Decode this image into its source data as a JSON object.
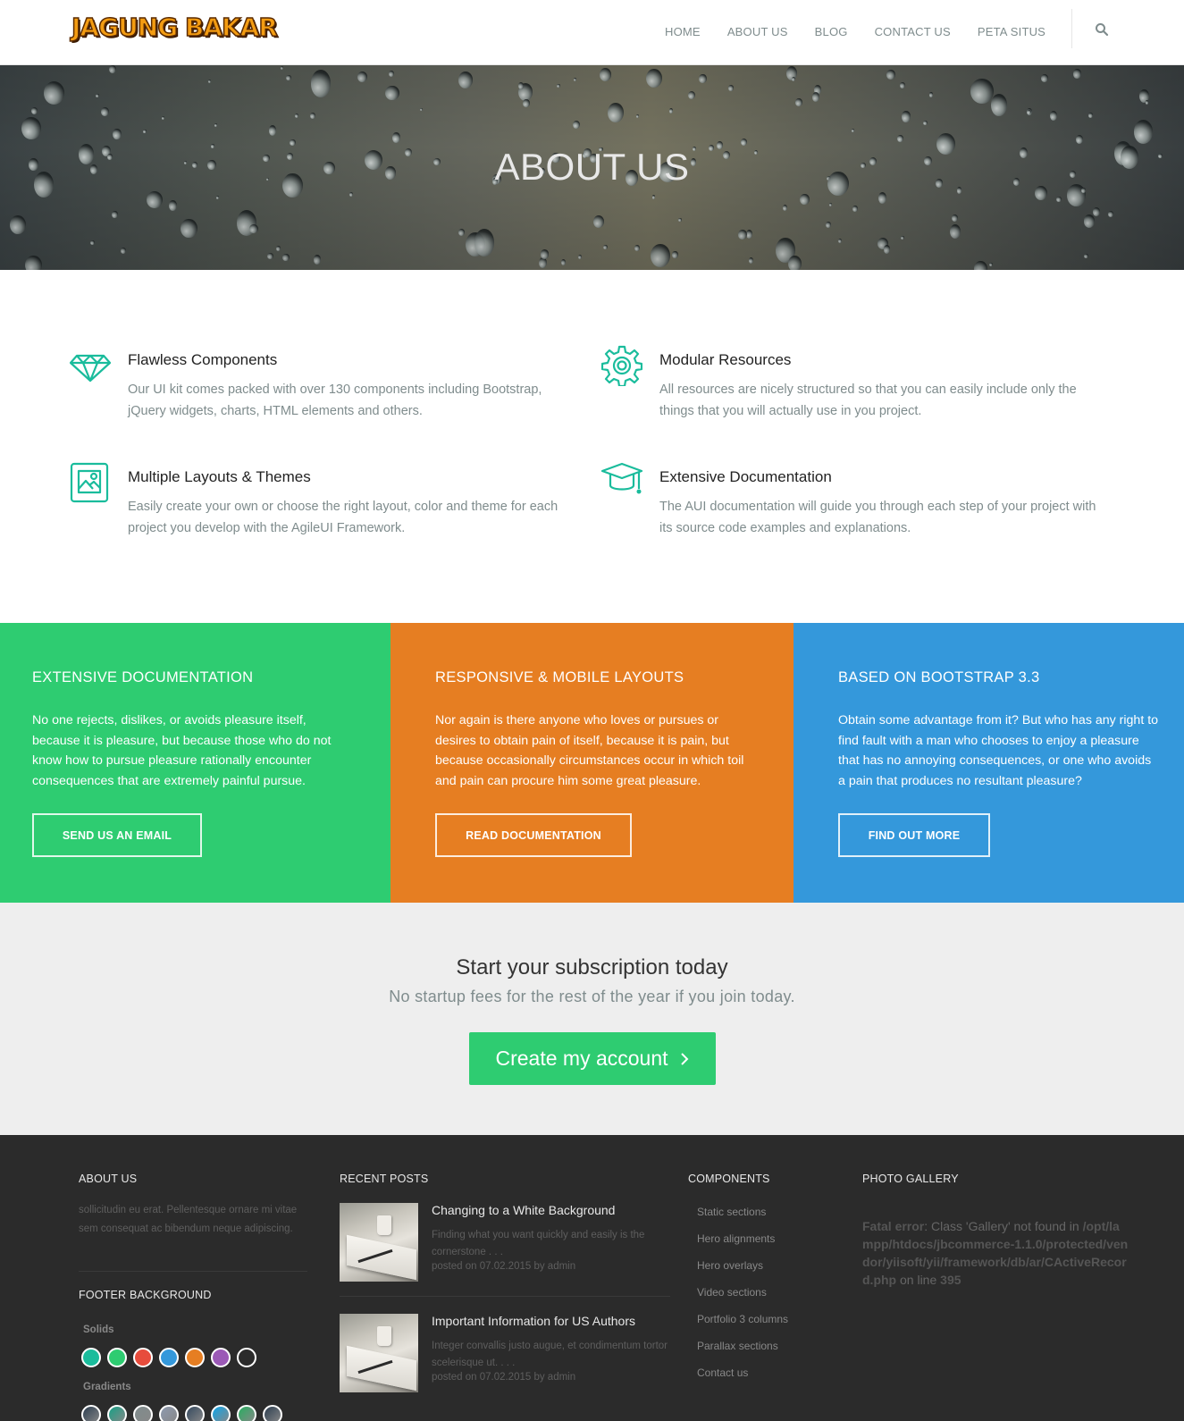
{
  "header": {
    "logo_text": "JAGUNG BAKAR",
    "nav": [
      "HOME",
      "ABOUT US",
      "BLOG",
      "CONTACT US",
      "PETA SITUS"
    ],
    "search_icon": "search-icon"
  },
  "hero": {
    "title": "ABOUT US"
  },
  "features": [
    {
      "icon": "diamond-icon",
      "title": "Flawless Components",
      "text": "Our UI kit comes packed with over 130 components including Bootstrap, jQuery widgets, charts, HTML elements and others."
    },
    {
      "icon": "gear-icon",
      "title": "Modular Resources",
      "text": "All resources are nicely structured so that you can easily include only the things that you will actually use in you project."
    },
    {
      "icon": "image-icon",
      "title": "Multiple Layouts & Themes",
      "text": "Easily create your own or choose the right layout, color and theme for each project you develop with the AgileUI Framework."
    },
    {
      "icon": "graduation-cap-icon",
      "title": "Extensive Documentation",
      "text": "The AUI documentation will guide you through each step of your project with its source code examples and explanations."
    }
  ],
  "blocks": [
    {
      "color": "#2ecc71",
      "title": "EXTENSIVE DOCUMENTATION",
      "text": "No one rejects, dislikes, or avoids pleasure itself, because it is pleasure, but because those who do not know how to pursue pleasure rationally encounter consequences that are extremely painful pursue.",
      "button": "SEND US AN EMAIL"
    },
    {
      "color": "#e67e22",
      "title": "RESPONSIVE & MOBILE LAYOUTS",
      "text": "Nor again is there anyone who loves or pursues or desires to obtain pain of itself, because it is pain, but because occasionally circumstances occur in which toil and pain can procure him some great pleasure.",
      "button": "READ DOCUMENTATION"
    },
    {
      "color": "#3498db",
      "title": "BASED ON BOOTSTRAP 3.3",
      "text": "Obtain some advantage from it? But who has any right to find fault with a man who chooses to enjoy a pleasure that has no annoying consequences, or one who avoids a pain that produces no resultant pleasure?",
      "button": "FIND OUT MORE"
    }
  ],
  "subscription": {
    "title": "Start your subscription today",
    "lead": "No startup fees for the rest of the year if you join today.",
    "cta": "Create my account",
    "cta_icon": "chevron-right-icon"
  },
  "footer": {
    "about": {
      "heading": "ABOUT US",
      "text": "sollicitudin eu erat. Pellentesque ornare mi vitae sem consequat ac bibendum neque adipiscing."
    },
    "background": {
      "heading": "FOOTER BACKGROUND",
      "solids_label": "Solids",
      "solids": [
        "#1abc9c",
        "#2ecc71",
        "#e74c3c",
        "#3498db",
        "#e67e22",
        "#9b59b6",
        "#2b2b2b"
      ],
      "gradients_label": "Gradients",
      "gradients": [
        "#2c3e50",
        "#16a085",
        "#7f8c8d",
        "#8e9aaf",
        "#34495e",
        "#0ea5e9",
        "#27ae60",
        "#2c3e50"
      ]
    },
    "recent_posts": {
      "heading": "RECENT POSTS",
      "posts": [
        {
          "title": "Changing to a White Background",
          "excerpt": "Finding what you want quickly and easily is the cornerstone . . .",
          "meta": "posted on 07.02.2015 by admin"
        },
        {
          "title": "Important Information for US Authors",
          "excerpt": "Integer convallis justo augue, et condimentum tortor scelerisque ut. . . .",
          "meta": "posted on 07.02.2015 by admin"
        }
      ]
    },
    "components": {
      "heading": "COMPONENTS",
      "links": [
        "Static sections",
        "Hero alignments",
        "Hero overlays",
        "Video sections",
        "Portfolio 3 columns",
        "Parallax sections",
        "Contact us"
      ]
    },
    "gallery": {
      "heading": "PHOTO GALLERY",
      "error_label": "Fatal error",
      "error_message": ": Class 'Gallery' not found in",
      "error_path": "/opt/lampp/htdocs/jbcommerce-1.1.0/protected/vendor/yiisoft/yii/framework/db/ar/CActiveRecord.php",
      "error_line_prefix": "on line",
      "error_line": "395"
    }
  }
}
